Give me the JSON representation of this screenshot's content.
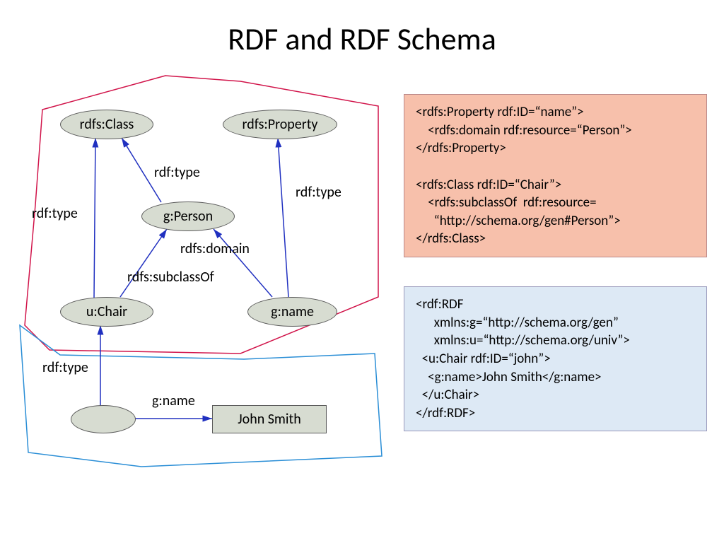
{
  "title": "RDF and RDF Schema",
  "nodes": {
    "rdfs_class": "rdfs:Class",
    "rdfs_property": "rdfs:Property",
    "g_person": "g:Person",
    "u_chair": "u:Chair",
    "g_name": "g:name",
    "john_smith": "John Smith"
  },
  "edges": {
    "type1": "rdf:type",
    "type2": "rdf:type",
    "type3": "rdf:type",
    "type4": "rdf:type",
    "subclass": "rdfs:subclassOf",
    "domain": "rdfs:domain",
    "gname": "g:name"
  },
  "code_pink": "<rdfs:Property rdf:ID=“name”>\n    <rdfs:domain rdf:resource=“Person”>\n</rdfs:Property>\n\n<rdfs:Class rdf:ID=“Chair”>\n    <rdfs:subclassOf  rdf:resource=\n      “http://schema.org/gen#Person”>\n</rdfs:Class>",
  "code_blue": "<rdf:RDF\n      xmlns:g=“http://schema.org/gen”\n      xmlns:u=“http://schema.org/univ”>\n  <u:Chair rdf:ID=“john”>\n    <g:name>John Smith</g:name>\n  </u:Chair>\n</rdf:RDF>"
}
